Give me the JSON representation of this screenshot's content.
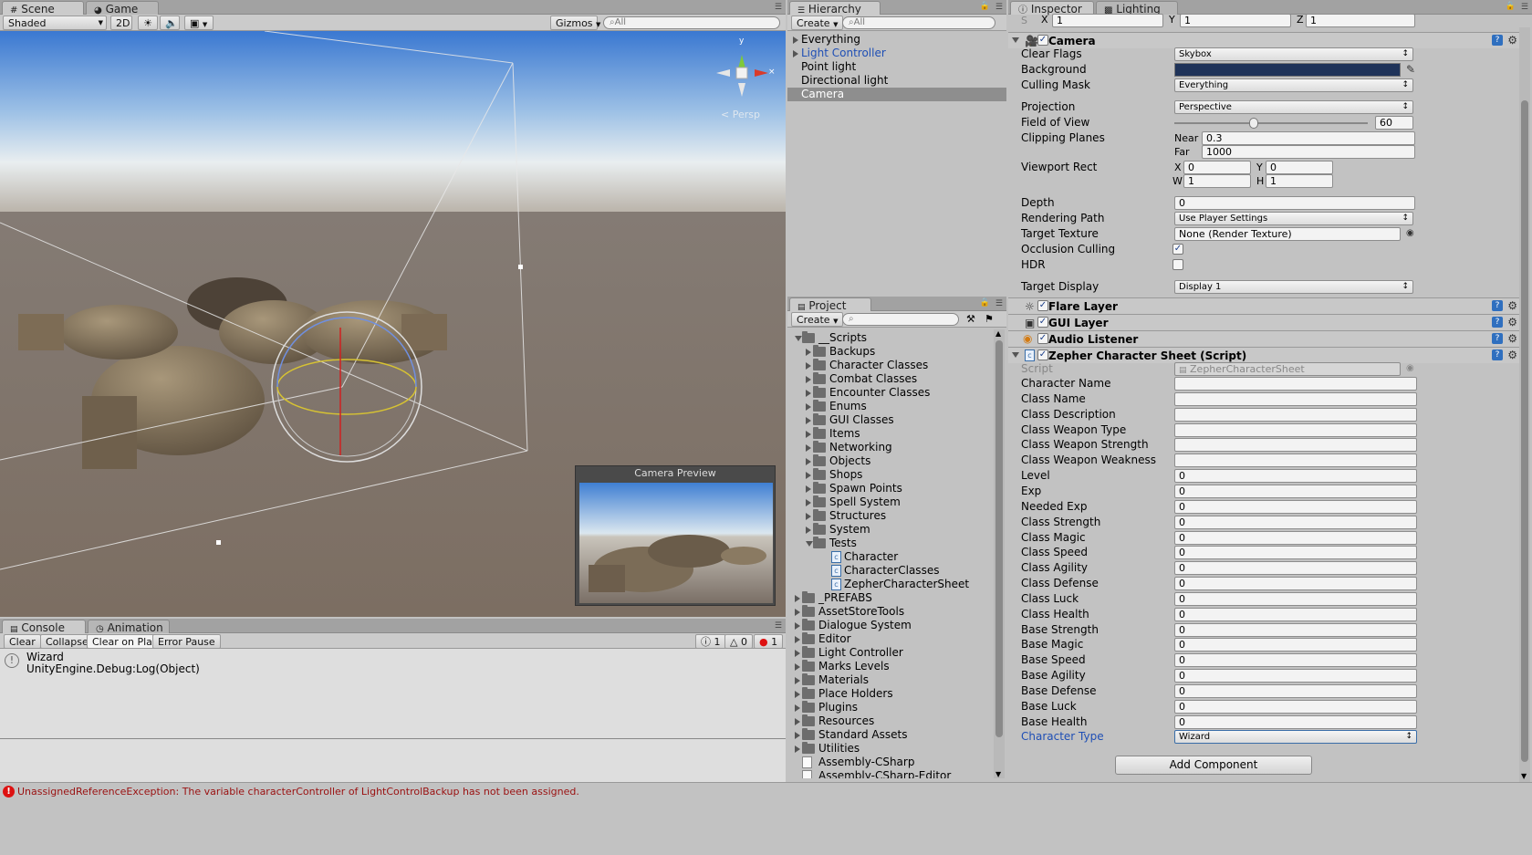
{
  "scene": {
    "tabs": [
      "Scene",
      "Game"
    ],
    "shading": "Shaded",
    "btn_2d": "2D",
    "gizmos": "Gizmos",
    "search_placeholder": "All",
    "persp": "Persp",
    "gizmo_y": "y",
    "camera_preview_title": "Camera Preview"
  },
  "console": {
    "tabs": [
      "Console",
      "Animation"
    ],
    "buttons": [
      "Clear",
      "Collapse",
      "Clear on Play",
      "Error Pause"
    ],
    "counts": {
      "info": "1",
      "warn": "0",
      "error": "1"
    },
    "log_line1": "Wizard",
    "log_line2": "UnityEngine.Debug:Log(Object)"
  },
  "hierarchy": {
    "tab": "Hierarchy",
    "create": "Create",
    "search_placeholder": "All",
    "items": [
      {
        "label": "Everything",
        "expand": true,
        "color": "#000000",
        "selected": false
      },
      {
        "label": "Light Controller",
        "expand": true,
        "color": "#1f4fb5",
        "selected": false
      },
      {
        "label": "Point light",
        "expand": false,
        "color": "#000000",
        "selected": false
      },
      {
        "label": "Directional light",
        "expand": false,
        "color": "#000000",
        "selected": false
      },
      {
        "label": "Camera",
        "expand": false,
        "color": "#ffffff",
        "selected": true
      }
    ]
  },
  "project": {
    "tab": "Project",
    "create": "Create",
    "items": [
      {
        "label": "__Scripts",
        "level": 0,
        "type": "folder",
        "open": true
      },
      {
        "label": "Backups",
        "level": 1,
        "type": "folder"
      },
      {
        "label": "Character Classes",
        "level": 1,
        "type": "folder"
      },
      {
        "label": "Combat Classes",
        "level": 1,
        "type": "folder"
      },
      {
        "label": "Encounter Classes",
        "level": 1,
        "type": "folder"
      },
      {
        "label": "Enums",
        "level": 1,
        "type": "folder"
      },
      {
        "label": "GUI Classes",
        "level": 1,
        "type": "folder"
      },
      {
        "label": "Items",
        "level": 1,
        "type": "folder"
      },
      {
        "label": "Networking",
        "level": 1,
        "type": "folder"
      },
      {
        "label": "Objects",
        "level": 1,
        "type": "folder"
      },
      {
        "label": "Shops",
        "level": 1,
        "type": "folder"
      },
      {
        "label": "Spawn Points",
        "level": 1,
        "type": "folder"
      },
      {
        "label": "Spell System",
        "level": 1,
        "type": "folder"
      },
      {
        "label": "Structures",
        "level": 1,
        "type": "folder"
      },
      {
        "label": "System",
        "level": 1,
        "type": "folder"
      },
      {
        "label": "Tests",
        "level": 1,
        "type": "folder",
        "open": true
      },
      {
        "label": "Character",
        "level": 2,
        "type": "script"
      },
      {
        "label": "CharacterClasses",
        "level": 2,
        "type": "script"
      },
      {
        "label": "ZepherCharacterSheet",
        "level": 2,
        "type": "script"
      },
      {
        "label": "_PREFABS",
        "level": 0,
        "type": "folder"
      },
      {
        "label": "AssetStoreTools",
        "level": 0,
        "type": "folder"
      },
      {
        "label": "Dialogue System",
        "level": 0,
        "type": "folder"
      },
      {
        "label": "Editor",
        "level": 0,
        "type": "folder"
      },
      {
        "label": "Light Controller",
        "level": 0,
        "type": "folder"
      },
      {
        "label": "Marks Levels",
        "level": 0,
        "type": "folder"
      },
      {
        "label": "Materials",
        "level": 0,
        "type": "folder"
      },
      {
        "label": "Place Holders",
        "level": 0,
        "type": "folder"
      },
      {
        "label": "Plugins",
        "level": 0,
        "type": "folder"
      },
      {
        "label": "Resources",
        "level": 0,
        "type": "folder"
      },
      {
        "label": "Standard Assets",
        "level": 0,
        "type": "folder"
      },
      {
        "label": "Utilities",
        "level": 0,
        "type": "folder"
      },
      {
        "label": "Assembly-CSharp",
        "level": 0,
        "type": "file"
      },
      {
        "label": "Assembly-CSharp-Editor",
        "level": 0,
        "type": "file"
      }
    ]
  },
  "inspector": {
    "tabs": [
      "Inspector",
      "Lighting"
    ],
    "scale": {
      "x": "1",
      "y": "1",
      "z": "1",
      "s_label": "S"
    },
    "camera": {
      "title": "Camera",
      "clear_flags_label": "Clear Flags",
      "clear_flags": "Skybox",
      "background_label": "Background",
      "background_color": "#1f3359",
      "culling_mask_label": "Culling Mask",
      "culling_mask": "Everything",
      "projection_label": "Projection",
      "projection": "Perspective",
      "fov_label": "Field of View",
      "fov": "60",
      "fov_fraction": 0.41,
      "clipping_label": "Clipping Planes",
      "near_label": "Near",
      "near": "0.3",
      "far_label": "Far",
      "far": "1000",
      "viewport_label": "Viewport Rect",
      "vx": "0",
      "vy": "0",
      "vw": "1",
      "vh": "1",
      "depth_label": "Depth",
      "depth": "0",
      "rendering_path_label": "Rendering Path",
      "rendering_path": "Use Player Settings",
      "target_texture_label": "Target Texture",
      "target_texture": "None (Render Texture)",
      "occlusion_label": "Occlusion Culling",
      "occlusion": true,
      "hdr_label": "HDR",
      "hdr": false,
      "target_display_label": "Target Display",
      "target_display": "Display 1"
    },
    "components": [
      "Flare Layer",
      "GUI Layer",
      "Audio Listener"
    ],
    "script_comp": {
      "title": "Zepher Character Sheet (Script)",
      "script_label": "Script",
      "script_value": "ZepherCharacterSheet",
      "fields": [
        {
          "label": "Character Name",
          "value": ""
        },
        {
          "label": "Class Name",
          "value": ""
        },
        {
          "label": "Class Description",
          "value": ""
        },
        {
          "label": "Class Weapon Type",
          "value": ""
        },
        {
          "label": "Class Weapon Strength",
          "value": ""
        },
        {
          "label": "Class Weapon Weakness",
          "value": ""
        },
        {
          "label": "Level",
          "value": "0"
        },
        {
          "label": "Exp",
          "value": "0"
        },
        {
          "label": "Needed Exp",
          "value": "0"
        },
        {
          "label": "Class Strength",
          "value": "0"
        },
        {
          "label": "Class Magic",
          "value": "0"
        },
        {
          "label": "Class Speed",
          "value": "0"
        },
        {
          "label": "Class Agility",
          "value": "0"
        },
        {
          "label": "Class Defense",
          "value": "0"
        },
        {
          "label": "Class Luck",
          "value": "0"
        },
        {
          "label": "Class Health",
          "value": "0"
        },
        {
          "label": "Base Strength",
          "value": "0"
        },
        {
          "label": "Base Magic",
          "value": "0"
        },
        {
          "label": "Base Speed",
          "value": "0"
        },
        {
          "label": "Base Agility",
          "value": "0"
        },
        {
          "label": "Base Defense",
          "value": "0"
        },
        {
          "label": "Base Luck",
          "value": "0"
        },
        {
          "label": "Base Health",
          "value": "0"
        }
      ],
      "char_type_label": "Character Type",
      "char_type": "Wizard"
    },
    "add_component": "Add Component"
  },
  "status": {
    "error": "UnassignedReferenceException: The variable characterController of LightControlBackup has not been assigned."
  }
}
